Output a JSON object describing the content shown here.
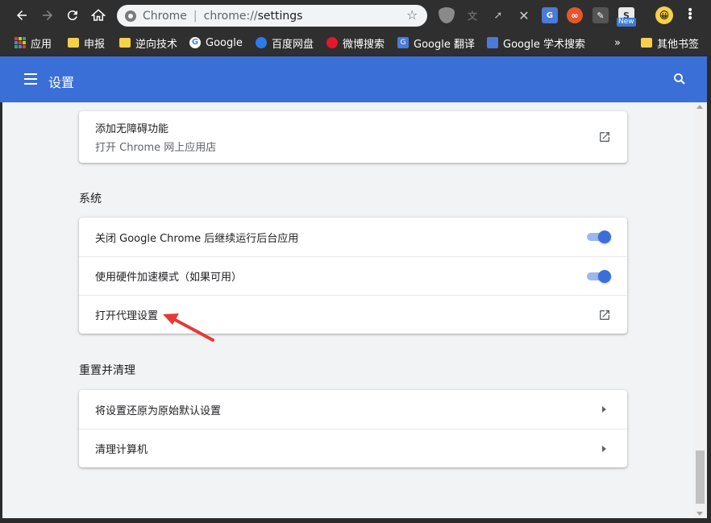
{
  "browser": {
    "omnibox": {
      "chip_label": "Chrome",
      "url_scheme": "chrome://",
      "url_path": "settings"
    },
    "extensions": [
      {
        "name": "shield-extension",
        "color": "#8a8a8a"
      },
      {
        "name": "translate-extension",
        "color": "#5a5a5a"
      },
      {
        "name": "cursor-extension",
        "color": "#6a6a6a"
      },
      {
        "name": "x-extension",
        "color": "#7a7a7a"
      },
      {
        "name": "google-translate-extension",
        "color": "#4a7bd8"
      },
      {
        "name": "infinity-extension",
        "color": "#e4572e"
      },
      {
        "name": "pen-extension",
        "color": "#555555"
      },
      {
        "name": "new-extension",
        "color": "#3b7bd6"
      }
    ],
    "new_badge": "New"
  },
  "bookmarks": {
    "items": [
      {
        "label": "应用",
        "icon": "apps-grid-icon"
      },
      {
        "label": "申报",
        "icon": "folder-icon"
      },
      {
        "label": "逆向技术",
        "icon": "folder-icon"
      },
      {
        "label": "Google",
        "icon": "google-icon"
      },
      {
        "label": "百度网盘",
        "icon": "baidu-pan-icon"
      },
      {
        "label": "微博搜索",
        "icon": "weibo-icon"
      },
      {
        "label": "Google 翻译",
        "icon": "google-translate-icon"
      },
      {
        "label": "Google 学术搜索",
        "icon": "scholar-icon"
      }
    ],
    "overflow": "»",
    "other": "其他书签"
  },
  "header": {
    "title": "设置"
  },
  "top_card": {
    "primary": "添加无障碍功能",
    "secondary": "打开 Chrome 网上应用店"
  },
  "system": {
    "title": "系统",
    "rows": [
      {
        "label": "关闭 Google Chrome 后继续运行后台应用",
        "control": "toggle",
        "checked": true
      },
      {
        "label": "使用硬件加速模式（如果可用）",
        "control": "toggle",
        "checked": true
      },
      {
        "label": "打开代理设置",
        "control": "external-link"
      }
    ]
  },
  "reset": {
    "title": "重置并清理",
    "rows": [
      {
        "label": "将设置还原为原始默认设置",
        "control": "chevron"
      },
      {
        "label": "清理计算机",
        "control": "chevron"
      }
    ]
  },
  "colors": {
    "header_blue": "#3b6fd8",
    "toggle_knob": "#3b6fd8",
    "toggle_track": "#9cb8ef",
    "annotation_red": "#e53935"
  }
}
